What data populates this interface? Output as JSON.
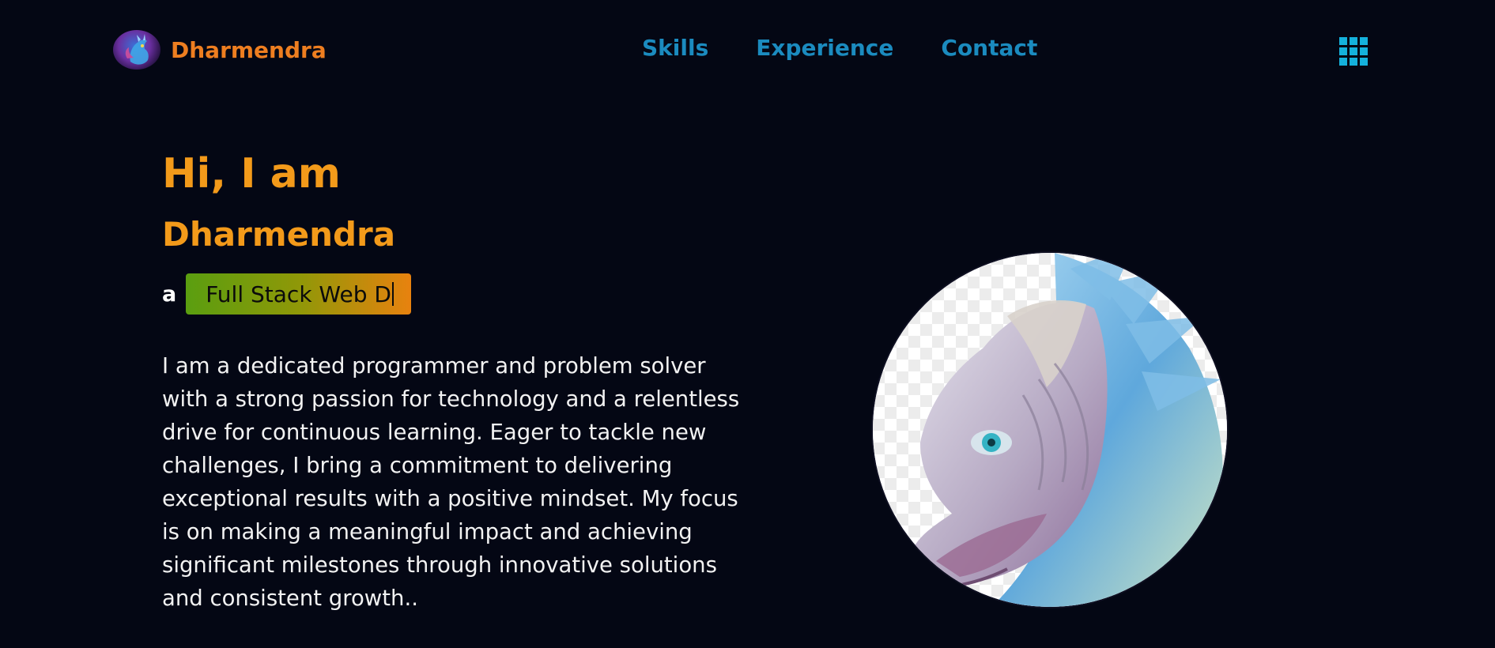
{
  "header": {
    "brand_name": "Dharmendra",
    "nav": [
      "Skills",
      "Experience",
      "Contact"
    ],
    "menu_icon": "grid-menu-icon"
  },
  "hero": {
    "greeting": "Hi, I am",
    "name": "Dharmendra",
    "role_prefix": "a",
    "typed_role": "Full Stack Web D",
    "bio": "I am a dedicated programmer and problem solver with a strong passion for technology and a relentless drive for continuous learning. Eager to tackle new challenges, I bring a commitment to delivering exceptional results with a positive mindset. My focus is on making a meaningful impact and achieving significant milestones through innovative solutions and consistent growth.."
  },
  "colors": {
    "background": "#040714",
    "brand": "#ee7e20",
    "nav_link": "#1b8bbf",
    "heading": "#f39a1a",
    "menu_icon": "#14b1dc",
    "chip_gradient_start": "#5a9e10",
    "chip_gradient_end": "#e8820f"
  },
  "images": {
    "avatar": "dragon-avatar",
    "portrait": "dragon-portrait"
  }
}
